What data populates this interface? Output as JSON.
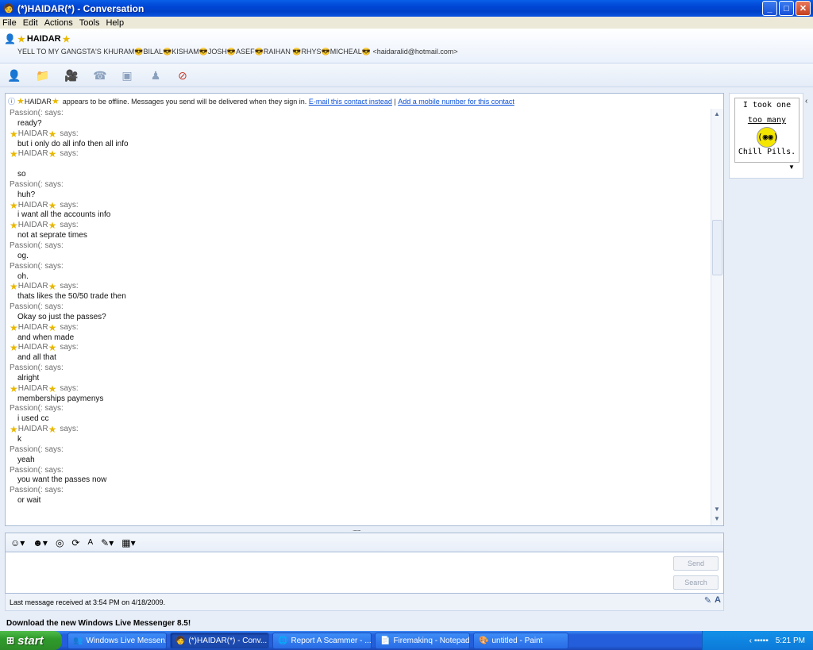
{
  "window": {
    "title": "(*)HAIDAR(*) - Conversation",
    "buttons": {
      "minimize": "_",
      "maximize": "□",
      "close": "✕"
    }
  },
  "menu": [
    "File",
    "Edit",
    "Actions",
    "Tools",
    "Help"
  ],
  "contact": {
    "name": "HAIDAR",
    "personal_message": "YELL TO MY GANGSTA'S KHURAM😎BILAL😎KISHAM😎JOSH😎ASEF😎RAIHAN 😎RHYS😎MICHEAL😎 <haidaralid@hotmail.com>"
  },
  "toolbar_icons": [
    "invite-icon",
    "share-files-icon",
    "video-icon",
    "call-icon",
    "activities-icon",
    "games-icon",
    "block-icon"
  ],
  "infobar": {
    "name": "HAIDAR",
    "message": "appears to be offline. Messages you send will be delivered when they sign in.",
    "link_email": "E-mail this contact instead",
    "separator": "|",
    "link_mobile": "Add a mobile number for this contact"
  },
  "messages": [
    {
      "sender": "Passion(: says:",
      "star": false,
      "text": "ready?"
    },
    {
      "sender": "HAIDAR",
      "star": true,
      "text": "but i only do all info then all info"
    },
    {
      "sender": "HAIDAR",
      "star": true,
      "text": "so",
      "gap": true
    },
    {
      "sender": "Passion(: says:",
      "star": false,
      "text": "huh?"
    },
    {
      "sender": "HAIDAR",
      "star": true,
      "text": "i want all the accounts info"
    },
    {
      "sender": "HAIDAR",
      "star": true,
      "text": "not at seprate times"
    },
    {
      "sender": "Passion(: says:",
      "star": false,
      "text": "og."
    },
    {
      "sender": "Passion(: says:",
      "star": false,
      "text": "oh."
    },
    {
      "sender": "HAIDAR",
      "star": true,
      "text": "thats likes the 50/50 trade then"
    },
    {
      "sender": "Passion(: says:",
      "star": false,
      "text": "Okay so just the passes?"
    },
    {
      "sender": "HAIDAR",
      "star": true,
      "text": "and when made"
    },
    {
      "sender": "HAIDAR",
      "star": true,
      "text": "and all that"
    },
    {
      "sender": "Passion(: says:",
      "star": false,
      "text": "alright"
    },
    {
      "sender": "HAIDAR",
      "star": true,
      "text": "memberships paymenys"
    },
    {
      "sender": "Passion(: says:",
      "star": false,
      "text": "i used cc"
    },
    {
      "sender": "HAIDAR",
      "star": true,
      "text": "k"
    },
    {
      "sender": "Passion(: says:",
      "star": false,
      "text": "yeah"
    },
    {
      "sender": "Passion(: says:",
      "star": false,
      "text": "you want the passes now"
    },
    {
      "sender": "Passion(: says:",
      "star": false,
      "text": "or wait"
    }
  ],
  "says_label": "says:",
  "compose": {
    "send": "Send",
    "search": "Search"
  },
  "status": "Last message received at 3:54 PM on 4/18/2009.",
  "download_banner": "Download the new Windows Live Messenger 8.5!",
  "display_picture": {
    "line1": "I took one",
    "line2": "too many",
    "line3": "Chill Pills."
  },
  "taskbar": {
    "start": "start",
    "tasks": [
      {
        "label": "Windows Live Messen...",
        "active": false
      },
      {
        "label": "(*)HAIDAR(*) - Conv...",
        "active": true
      },
      {
        "label": "Report A Scammer - ...",
        "active": false
      },
      {
        "label": "Firemakinq - Notepad",
        "active": false
      },
      {
        "label": "untitled - Paint",
        "active": false
      }
    ],
    "clock": "5:21 PM"
  },
  "colors": {
    "titlebar": "#0045d4",
    "link": "#0a4fd8",
    "start_green": "#2f9b2c",
    "star": "#e8b800"
  }
}
